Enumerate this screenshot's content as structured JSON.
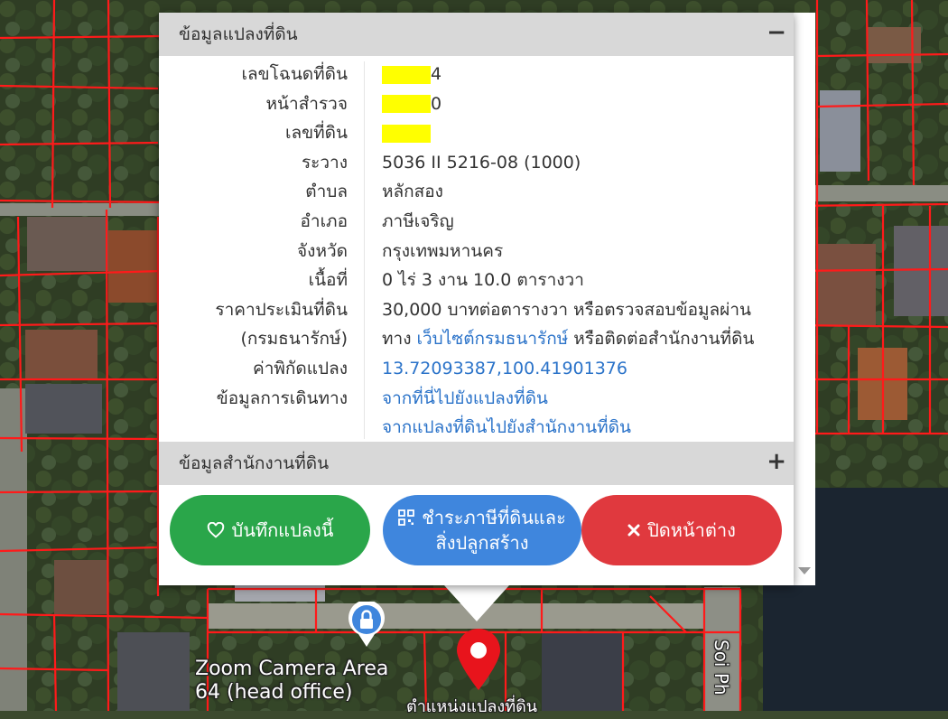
{
  "popup": {
    "land_section_title": "ข้อมูลแปลงที่ดิน",
    "land_section_toggle": "−",
    "rows": [
      {
        "label": "เลขโฉนดที่ดิน",
        "value": "4",
        "redacted": true
      },
      {
        "label": "หน้าสำรวจ",
        "value": "0",
        "redacted": true
      },
      {
        "label": "เลขที่ดิน",
        "value": "",
        "redacted": true
      },
      {
        "label": "ระวาง",
        "value": "5036 II 5216-08 (1000)"
      },
      {
        "label": "ตำบล",
        "value": "หลักสอง"
      },
      {
        "label": "อำเภอ",
        "value": "ภาษีเจริญ"
      },
      {
        "label": "จังหวัด",
        "value": "กรุงเทพมหานคร"
      },
      {
        "label": "เนื้อที่",
        "value": "0 ไร่ 3 งาน 10.0 ตารางวา"
      },
      {
        "label": "ราคาประเมินที่ดิน",
        "value": "30,000 บาทต่อตารางวา หรือตรวจสอบข้อมูลผ่าน"
      },
      {
        "label": "(กรมธนารักษ์)",
        "value_prefix": "ทาง ",
        "link": "เว็บไซต์กรมธนารักษ์",
        "value_suffix": " หรือติดต่อสำนักงานที่ดิน"
      },
      {
        "label": "ค่าพิกัดแปลง",
        "link": "13.72093387,100.41901376"
      },
      {
        "label": "ข้อมูลการเดินทาง",
        "link": "จากที่นี่ไปยังแปลงที่ดิน"
      },
      {
        "label": "",
        "link": "จากแปลงที่ดินไปยังสำนักงานที่ดิน"
      }
    ],
    "office_section_title": "ข้อมูลสำนักงานที่ดิน",
    "office_section_toggle": "+",
    "buttons": {
      "save": "บันทึกแปลงนี้",
      "tax_line1": "ชำระภาษีที่ดินและ",
      "tax_line2": "สิ่งปลูกสร้าง",
      "close": "ปิดหน้าต่าง"
    }
  },
  "map": {
    "label_zoom_line1": "Zoom Camera Area",
    "label_zoom_line2": "64 (head office)",
    "label_road": "Soi Ph",
    "label_bottom": "ตำแหน่งแปลงที่ดิน"
  },
  "colors": {
    "save": "#2aa64a",
    "tax": "#3f86dd",
    "close": "#e0393e",
    "link": "#2b73c9",
    "parcel_line": "#ff1a1a"
  }
}
